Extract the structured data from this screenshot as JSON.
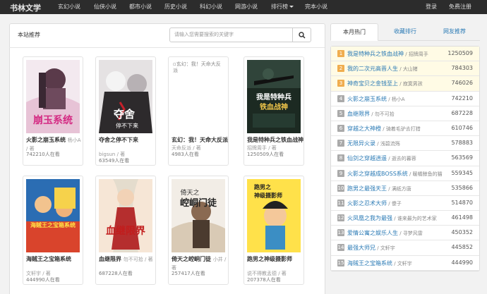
{
  "navbar": {
    "brand": "书林文学",
    "items": [
      "玄幻小说",
      "仙侠小说",
      "都市小说",
      "历史小说",
      "科幻小说",
      "网游小说",
      "排行榜",
      "完本小说"
    ],
    "login": "登录",
    "register": "免费注册"
  },
  "main": {
    "title": "本站推荐",
    "search_placeholder": "请输入您需要搜索的关键字",
    "books": [
      {
        "title": "火影之崩玉系统",
        "author": "杨小A",
        "author_suffix": " / 著",
        "reads": "742210人在看"
      },
      {
        "title": "夺舍之停不下来",
        "author": "bigsun",
        "author_suffix": " / 著",
        "reads": "63549人在看"
      },
      {
        "title": "玄幻：我！天命大反派",
        "author": "天命反派",
        "author_suffix": " / 著",
        "reads": "4983人在看",
        "cover_alt": "玄幻：我！天命大反派"
      },
      {
        "title": "我是特种兵之铁血战神",
        "author": "招牌周手",
        "author_suffix": " / 著",
        "reads": "1250509人在看"
      },
      {
        "title": "海贼王之宝箱系统",
        "author": "文轩宇",
        "author_suffix": " / 著",
        "reads": "444990人在看"
      },
      {
        "title": "血继限界",
        "author": "勿不可拾",
        "author_suffix": " / 著",
        "reads": "687228人在看"
      },
      {
        "title": "倚天之崆峒门徒",
        "author": "小井",
        "author_suffix": " / 著",
        "reads": "257417人在看"
      },
      {
        "title": "跑男之神级摄影师",
        "author": "说不得教孟德",
        "author_suffix": " / 著",
        "reads": "207378人在看"
      }
    ]
  },
  "cover_text": {
    "b1": "崩玉系统",
    "b2a": "夺舍",
    "b2b": "停不下来",
    "b4a": "我是特种兵",
    "b4b": "铁血战神",
    "b5": "海贼王之宝箱系统",
    "b6": "血继限界",
    "b7a": "倚天之",
    "b7b": "崆峒门徒",
    "b8a": "跑男之",
    "b8b": "神级摄影师"
  },
  "sidebar": {
    "tabs": [
      "本月热门",
      "收藏排行",
      "网友推荐"
    ],
    "rankings": [
      {
        "num": "1",
        "title": "我是特种兵之铁血战神",
        "author": "招牌周手",
        "count": "1250509"
      },
      {
        "num": "2",
        "title": "我的二次元高晋人生",
        "author": "大山猪",
        "count": "784303"
      },
      {
        "num": "3",
        "title": "神奇宝贝之金钱至上",
        "author": "寂寞男孩",
        "count": "746026"
      },
      {
        "num": "4",
        "title": "火影之崩玉系统",
        "author": "杨小A",
        "count": "742210"
      },
      {
        "num": "5",
        "title": "血继限界",
        "author": "勿不可拾",
        "count": "687228"
      },
      {
        "num": "6",
        "title": "穿越之大神橙",
        "author": "骑着毛驴去打猎",
        "count": "610746"
      },
      {
        "num": "7",
        "title": "无限异火录",
        "author": "浅碧流殇",
        "count": "578883"
      },
      {
        "num": "8",
        "title": "仙剑之穿越逍遥",
        "author": "逝去的暮蓉",
        "count": "563569"
      },
      {
        "num": "9",
        "title": "火影之穿越成BOSS系统",
        "author": "暖橘鲸鱼的猫",
        "count": "559345"
      },
      {
        "num": "10",
        "title": "跑男之最强天王",
        "author": "满纸方唐",
        "count": "535866"
      },
      {
        "num": "11",
        "title": "火影之忍术大师",
        "author": "傻子",
        "count": "514870"
      },
      {
        "num": "12",
        "title": "火凤凰之我为最强",
        "author": "谁来最为的艺术家",
        "count": "461498"
      },
      {
        "num": "13",
        "title": "爱情公寓之娱乐人生",
        "author": "寻梦风雷",
        "count": "450352"
      },
      {
        "num": "14",
        "title": "最强大师兄",
        "author": "文轩宇",
        "count": "445852"
      },
      {
        "num": "15",
        "title": "海贼王之宝箱系统",
        "author": "文轩宇",
        "count": "444990"
      }
    ]
  }
}
